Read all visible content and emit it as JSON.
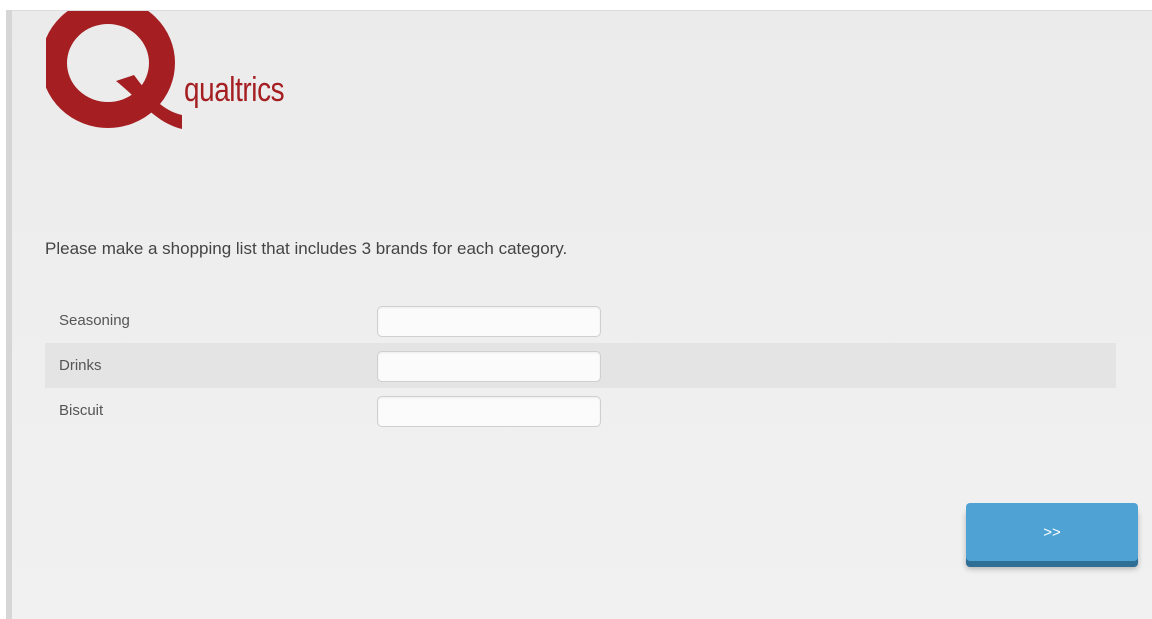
{
  "brand": {
    "name": "qualtrics",
    "color": "#a51f22"
  },
  "survey": {
    "question": "Please make a shopping list that includes 3 brands for each category.",
    "rows": [
      {
        "label": "Seasoning",
        "value": ""
      },
      {
        "label": "Drinks",
        "value": ""
      },
      {
        "label": "Biscuit",
        "value": ""
      }
    ]
  },
  "navigation": {
    "next_label": ">>",
    "button_color": "#4fa3d4"
  }
}
